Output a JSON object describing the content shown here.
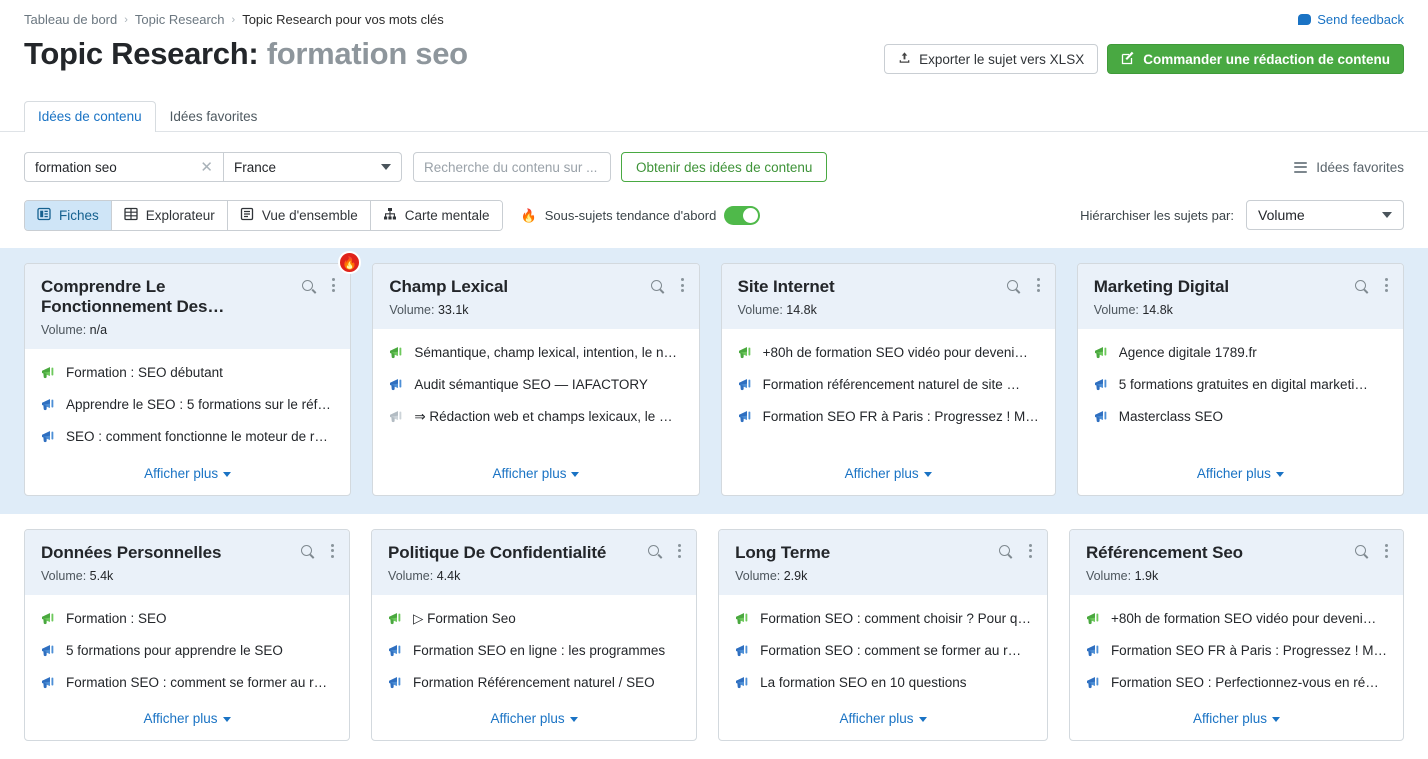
{
  "breadcrumb": {
    "items": [
      {
        "label": "Tableau de bord",
        "current": false
      },
      {
        "label": "Topic Research",
        "current": false
      },
      {
        "label": "Topic Research pour vos mots clés",
        "current": true
      }
    ],
    "separator": "›"
  },
  "feedback": {
    "label": "Send feedback",
    "icon": "speech-bubble-icon",
    "color": "#1a73c4"
  },
  "title": {
    "prefix": "Topic Research:",
    "keyword": "formation seo"
  },
  "header_buttons": {
    "export": {
      "label": "Exporter le sujet vers XLSX",
      "icon": "upload-icon"
    },
    "order": {
      "label": "Commander une rédaction de contenu",
      "icon": "edit-square-icon",
      "color": "#49a942"
    }
  },
  "tabs": [
    {
      "label": "Idées de contenu",
      "active": true
    },
    {
      "label": "Idées favorites",
      "active": false
    }
  ],
  "search": {
    "keyword_value": "formation seo",
    "clear_icon": "close-icon",
    "country_value": "France",
    "country_caret": "chevron-down-icon",
    "content_placeholder": "Recherche du contenu sur ...",
    "submit_label": "Obtenir des idées de contenu"
  },
  "favorites_link": {
    "label": "Idées favorites",
    "icon": "list-icon"
  },
  "view_modes": [
    {
      "label": "Fiches",
      "icon": "cards-icon",
      "active": true
    },
    {
      "label": "Explorateur",
      "icon": "grid-icon",
      "active": false
    },
    {
      "label": "Vue d'ensemble",
      "icon": "overview-icon",
      "active": false
    },
    {
      "label": "Carte mentale",
      "icon": "mindmap-icon",
      "active": false
    }
  ],
  "trending_toggle": {
    "label": "Sous-sujets tendance d'abord",
    "icon": "flame-icon",
    "enabled": true,
    "color": "#4fb94a"
  },
  "rank": {
    "label": "Hiérarchiser les sujets par:",
    "value": "Volume",
    "caret": "chevron-down-icon"
  },
  "card_labels": {
    "volume_prefix": "Volume:",
    "show_more": "Afficher plus",
    "search_icon": "magnifier-icon",
    "menu_icon": "kebab-menu-icon",
    "trending_badge": "flame-icon"
  },
  "rows": [
    {
      "highlighted": true,
      "cards": [
        {
          "title": "Comprendre Le Fonctionnement Des…",
          "volume": "n/a",
          "badge": true,
          "items": [
            {
              "text": "Formation : SEO débutant",
              "icon": "megaphone-green-icon"
            },
            {
              "text": "Apprendre le SEO : 5 formations sur le réf…",
              "icon": "megaphone-blue-icon"
            },
            {
              "text": "SEO : comment fonctionne le moteur de r…",
              "icon": "megaphone-blue-icon"
            }
          ]
        },
        {
          "title": "Champ Lexical",
          "volume": "33.1k",
          "badge": false,
          "items": [
            {
              "text": "Sémantique, champ lexical, intention, le n…",
              "icon": "megaphone-green-icon"
            },
            {
              "text": "Audit sémantique SEO — IAFACTORY",
              "icon": "megaphone-blue-icon"
            },
            {
              "text": "⇒ Rédaction web et champs lexicaux, le …",
              "icon": "megaphone-grey-icon"
            }
          ]
        },
        {
          "title": "Site Internet",
          "volume": "14.8k",
          "badge": false,
          "items": [
            {
              "text": "+80h de formation SEO vidéo pour deveni…",
              "icon": "megaphone-green-icon"
            },
            {
              "text": "Formation référencement naturel de site …",
              "icon": "megaphone-blue-icon"
            },
            {
              "text": "Formation SEO FR à Paris : Progressez ! M…",
              "icon": "megaphone-blue-icon"
            }
          ]
        },
        {
          "title": "Marketing Digital",
          "volume": "14.8k",
          "badge": false,
          "items": [
            {
              "text": "Agence digitale 1789.fr",
              "icon": "megaphone-green-icon"
            },
            {
              "text": "5 formations gratuites en digital marketi…",
              "icon": "megaphone-blue-icon"
            },
            {
              "text": "Masterclass SEO",
              "icon": "megaphone-blue-icon"
            }
          ]
        }
      ]
    },
    {
      "highlighted": false,
      "cards": [
        {
          "title": "Données Personnelles",
          "volume": "5.4k",
          "badge": false,
          "items": [
            {
              "text": "Formation : SEO",
              "icon": "megaphone-green-icon"
            },
            {
              "text": "5 formations pour apprendre le SEO",
              "icon": "megaphone-blue-icon"
            },
            {
              "text": "Formation SEO : comment se former au r…",
              "icon": "megaphone-blue-icon"
            }
          ]
        },
        {
          "title": "Politique De Confidentialité",
          "volume": "4.4k",
          "badge": false,
          "items": [
            {
              "text": "▷ Formation Seo",
              "icon": "megaphone-green-icon"
            },
            {
              "text": "Formation SEO en ligne : les programmes",
              "icon": "megaphone-blue-icon"
            },
            {
              "text": "Formation Référencement naturel / SEO",
              "icon": "megaphone-blue-icon"
            }
          ]
        },
        {
          "title": "Long Terme",
          "volume": "2.9k",
          "badge": false,
          "items": [
            {
              "text": "Formation SEO : comment choisir ? Pour q…",
              "icon": "megaphone-green-icon"
            },
            {
              "text": "Formation SEO : comment se former au r…",
              "icon": "megaphone-blue-icon"
            },
            {
              "text": "La formation SEO en 10 questions",
              "icon": "megaphone-blue-icon"
            }
          ]
        },
        {
          "title": "Référencement Seo",
          "volume": "1.9k",
          "badge": false,
          "items": [
            {
              "text": "+80h de formation SEO vidéo pour deveni…",
              "icon": "megaphone-green-icon"
            },
            {
              "text": "Formation SEO FR à Paris : Progressez ! M…",
              "icon": "megaphone-blue-icon"
            },
            {
              "text": "Formation SEO : Perfectionnez-vous en ré…",
              "icon": "megaphone-blue-icon"
            }
          ]
        }
      ]
    }
  ]
}
